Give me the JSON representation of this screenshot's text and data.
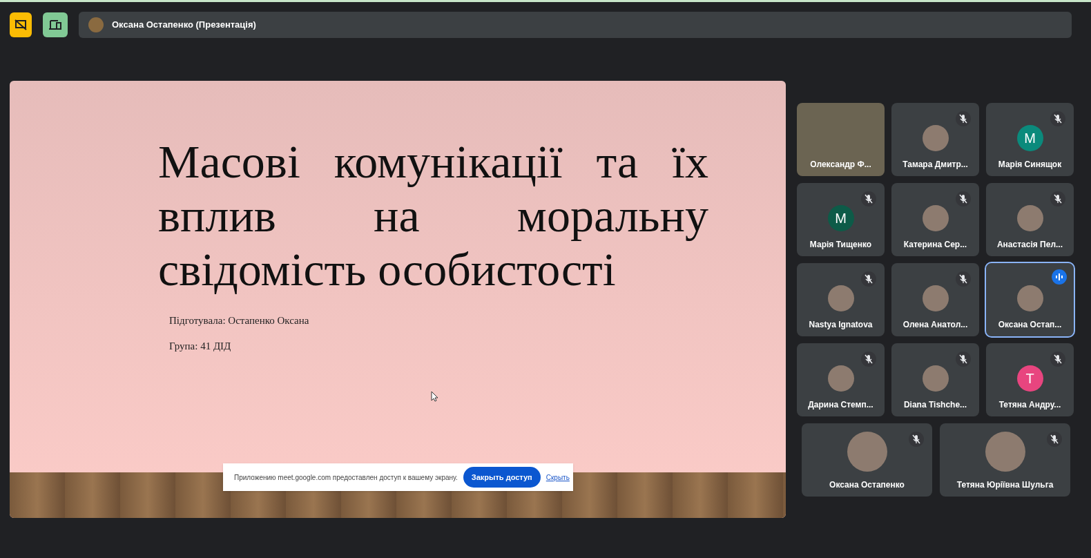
{
  "top_bar": {
    "presenter": "Оксана Остапенко (Презентація)"
  },
  "slide": {
    "title": "Масові комунікації та їх вплив на моральну свідомість особистості",
    "lines": [
      "Підготувала: Остапенко Оксана",
      "Група: 41 ДІД"
    ]
  },
  "share_banner": {
    "message": "Приложению meet.google.com предоставлен доступ к вашему экрану.",
    "stop_button": "Закрыть доступ",
    "hide_link": "Скрыть"
  },
  "participants": [
    {
      "name": "Олександр Ф...",
      "kind": "video",
      "muted": false,
      "speaking": false
    },
    {
      "name": "Тамара Дмитр...",
      "kind": "photo",
      "muted": true,
      "speaking": false
    },
    {
      "name": "Марія Синящок",
      "kind": "initial",
      "initial": "M",
      "color": "#0b8a7c",
      "muted": true,
      "speaking": false
    },
    {
      "name": "Марія Тищенко",
      "kind": "initial",
      "initial": "M",
      "color": "#0d5b48",
      "muted": true,
      "speaking": false
    },
    {
      "name": "Катерина Сер...",
      "kind": "photo",
      "muted": true,
      "speaking": false
    },
    {
      "name": "Анастасія Пел...",
      "kind": "photo",
      "muted": true,
      "speaking": false
    },
    {
      "name": "Nastya Ignatova",
      "kind": "photo",
      "muted": true,
      "speaking": false
    },
    {
      "name": "Олена Анатол...",
      "kind": "photo",
      "muted": true,
      "speaking": false
    },
    {
      "name": "Оксана Остап...",
      "kind": "photo",
      "muted": false,
      "speaking": true
    },
    {
      "name": "Дарина Стемп...",
      "kind": "photo",
      "muted": true,
      "speaking": false
    },
    {
      "name": "Diana Tishche...",
      "kind": "photo",
      "muted": true,
      "speaking": false
    },
    {
      "name": "Тетяна Андру...",
      "kind": "initial",
      "initial": "T",
      "color": "#e8457f",
      "muted": true,
      "speaking": false
    },
    {
      "name": "Оксана Остапенко",
      "kind": "photo",
      "muted": true,
      "speaking": false
    },
    {
      "name": "Тетяна Юріївна Шульга",
      "kind": "photo",
      "muted": true,
      "speaking": false
    }
  ]
}
